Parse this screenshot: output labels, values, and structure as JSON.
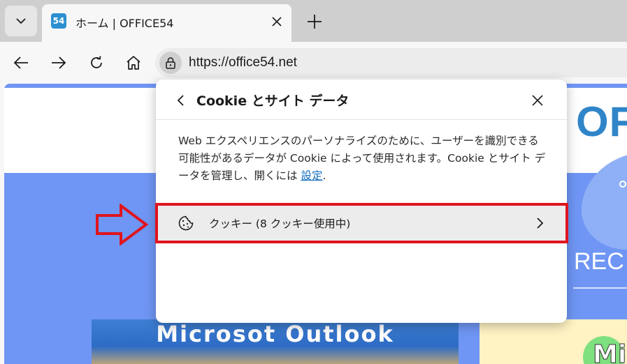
{
  "browser": {
    "tab": {
      "favicon_text": "54",
      "title": "ホーム | OFFICE54"
    },
    "icons": {
      "tab_list": "chevron-down-icon",
      "tab_close": "close-icon",
      "new_tab": "plus-icon",
      "back": "arrow-left-icon",
      "forward": "arrow-right-icon",
      "refresh": "refresh-icon",
      "home": "home-icon",
      "site_info": "lock-icon"
    },
    "address_bar": {
      "url": "https://office54.net"
    }
  },
  "page": {
    "logo_text": "OFF",
    "rec_text": "REC",
    "outlook_banner": "Microsot Outlook",
    "mi_text": "Mi"
  },
  "popup": {
    "title": "Cookie とサイト データ",
    "description": "Web エクスペリエンスのパーソナライズのために、ユーザーを識別できる可能性があるデータが Cookie によって使用されます。Cookie とサイト データを管理し、開くには",
    "settings_link": "設定",
    "period": ".",
    "cookie_row_label": "クッキー (8 クッキー使用中)",
    "icons": {
      "back": "chevron-left-icon",
      "close": "close-icon",
      "cookie": "cookie-icon",
      "row_chevron": "chevron-right-icon"
    }
  },
  "annotation": {
    "arrow_color": "#e0141e",
    "highlight_color": "#e0141e"
  }
}
